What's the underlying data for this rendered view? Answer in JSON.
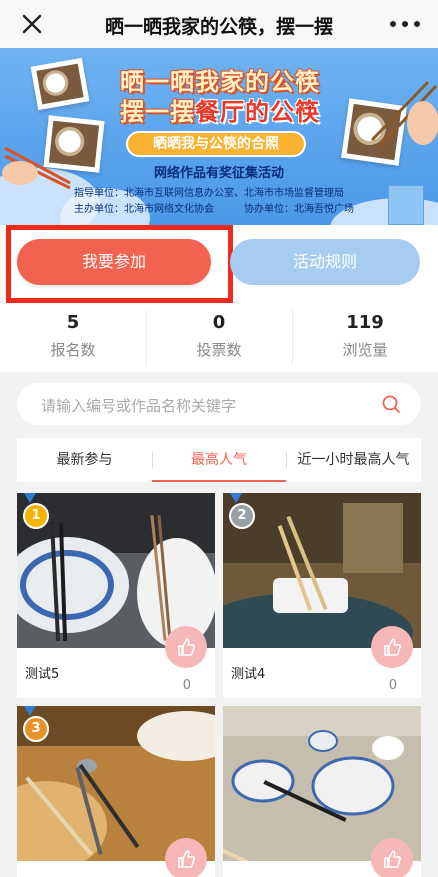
{
  "topbar": {
    "title": "晒一晒我家的公筷，摆一摆"
  },
  "banner": {
    "title_line1": "晒一晒我家的公筷",
    "title_line2_a": "摆一摆",
    "title_line2_b": "餐厅的公筷",
    "pill": "晒晒我与公筷的合照",
    "subtitle": "网络作品有奖征集活动",
    "guide_label": "指导单位：",
    "guide_value": "北海市互联网信息办公室、北海市市场监督管理局",
    "host_label": "主办单位：",
    "host_value": "北海市网络文化协会",
    "co_label": "协办单位：",
    "co_value": "北海吾悦广场"
  },
  "actions": {
    "join": "我要参加",
    "rules": "活动规则"
  },
  "stats": [
    {
      "value": "5",
      "label": "报名数"
    },
    {
      "value": "0",
      "label": "投票数"
    },
    {
      "value": "119",
      "label": "浏览量"
    }
  ],
  "search": {
    "placeholder": "请输入编号或作品名称关键字"
  },
  "tabs": [
    "最新参与",
    "最高人气",
    "近一小时最高人气"
  ],
  "entries": [
    {
      "rank": "1",
      "name": "测试5",
      "votes": "0",
      "rank_color": "#f4b400"
    },
    {
      "rank": "2",
      "name": "测试4",
      "votes": "0",
      "rank_color": "#9aa0a6"
    },
    {
      "rank": "3",
      "name": "",
      "votes": "",
      "rank_color": "#e8912a"
    },
    {
      "rank": "",
      "name": "",
      "votes": "",
      "rank_color": ""
    }
  ],
  "colors": {
    "accent": "#f26250",
    "rules": "#a7ccf1",
    "highlight_box": "#ee2a1f"
  }
}
